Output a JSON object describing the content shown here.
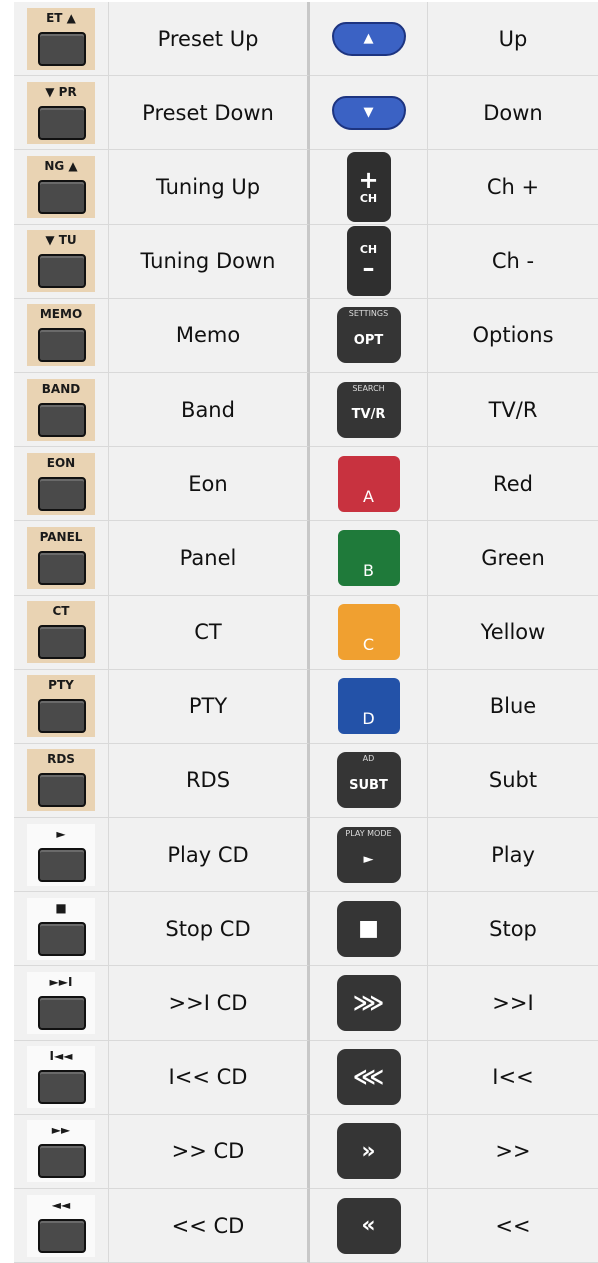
{
  "rows": [
    {
      "left_cap": "ET ▲",
      "left_label": "Preset Up",
      "right_icon": "up-arrow-button",
      "right_glyph": "▲",
      "right_label": "Up"
    },
    {
      "left_cap": "▼ PR",
      "left_label": "Preset Down",
      "right_icon": "down-arrow-button",
      "right_glyph": "▼",
      "right_label": "Down"
    },
    {
      "left_cap": "NG ▲",
      "left_label": "Tuning Up",
      "right_icon": "channel-up-button",
      "right_glyph": "+",
      "right_sub": "CH",
      "right_label": "Ch +"
    },
    {
      "left_cap": "▼ TU",
      "left_label": "Tuning Down",
      "right_icon": "channel-down-button",
      "right_glyph": "–",
      "right_sub": "CH",
      "right_label": "Ch -"
    },
    {
      "left_cap": "MEMO",
      "left_label": "Memo",
      "right_icon": "options-button",
      "right_top": "SETTINGS",
      "right_glyph": "OPT",
      "right_label": "Options"
    },
    {
      "left_cap": "BAND",
      "left_label": "Band",
      "right_icon": "tv-radio-button",
      "right_top": "SEARCH",
      "right_glyph": "TV/R",
      "right_label": "TV/R"
    },
    {
      "left_cap": "EON",
      "left_label": "Eon",
      "right_icon": "red-button",
      "right_glyph": "A",
      "right_color": "#c8323f",
      "right_label": "Red"
    },
    {
      "left_cap": "PANEL",
      "left_label": "Panel",
      "right_icon": "green-button",
      "right_glyph": "B",
      "right_color": "#1f7a3a",
      "right_label": "Green"
    },
    {
      "left_cap": "CT",
      "left_label": "CT",
      "right_icon": "yellow-button",
      "right_glyph": "C",
      "right_color": "#f0a030",
      "right_label": "Yellow"
    },
    {
      "left_cap": "PTY",
      "left_label": "PTY",
      "right_icon": "blue-button",
      "right_glyph": "D",
      "right_color": "#2352a8",
      "right_label": "Blue"
    },
    {
      "left_cap": "RDS",
      "left_label": "RDS",
      "right_icon": "subtitle-button",
      "right_top": "AD",
      "right_glyph": "SUBT",
      "right_label": "Subt"
    },
    {
      "left_cap": "►",
      "left_label": "Play CD",
      "right_icon": "play-button",
      "right_top": "PLAY MODE",
      "right_glyph": "►",
      "right_label": "Play"
    },
    {
      "left_cap": "■",
      "left_label": "Stop CD",
      "right_icon": "stop-button",
      "right_glyph": "■",
      "right_label": "Stop"
    },
    {
      "left_cap": "►►I",
      "left_label": ">>I CD",
      "right_icon": "next-track-button",
      "right_glyph": "⋙",
      "right_label": ">>I"
    },
    {
      "left_cap": "I◄◄",
      "left_label": "I<< CD",
      "right_icon": "previous-track-button",
      "right_glyph": "⋘",
      "right_label": "I<<"
    },
    {
      "left_cap": "►►",
      "left_label": ">> CD",
      "right_icon": "fast-forward-button",
      "right_glyph": "»",
      "right_label": ">>"
    },
    {
      "left_cap": "◄◄",
      "left_label": "<< CD",
      "right_icon": "rewind-button",
      "right_glyph": "«",
      "right_label": "<<"
    }
  ]
}
